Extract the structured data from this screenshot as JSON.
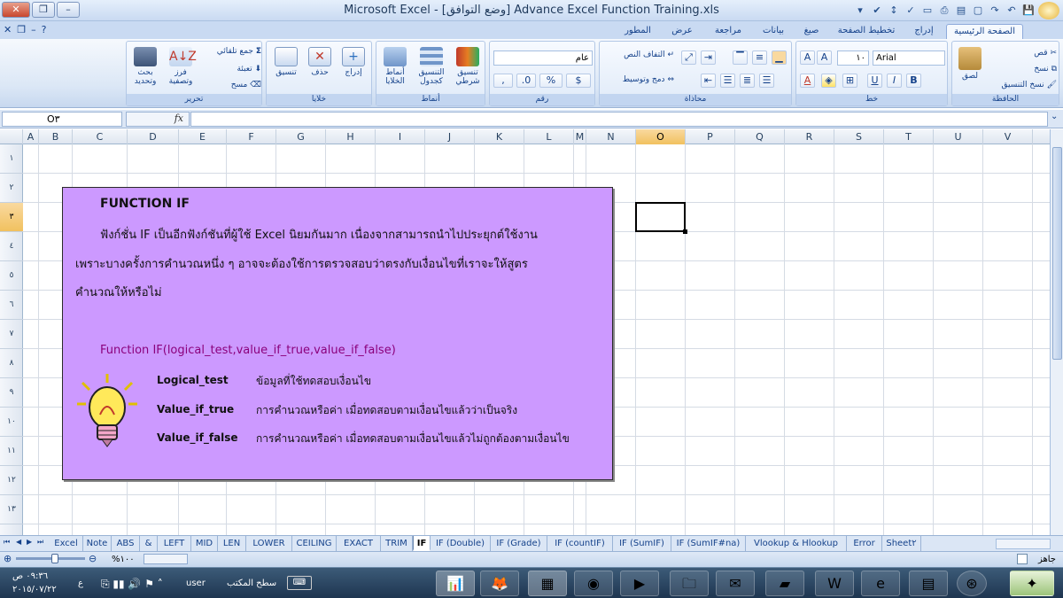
{
  "window": {
    "title": "Microsoft Excel - [وضع التوافق]  Advance Excel Function Training.xls"
  },
  "tabs": [
    "الصفحة الرئيسية",
    "إدراج",
    "تخطيط الصفحة",
    "صيغ",
    "بيانات",
    "مراجعة",
    "عرض",
    "المطور"
  ],
  "ribbon": {
    "clipboard": {
      "label": "الحافظة",
      "paste": "لصق",
      "cut": "قص",
      "copy": "نسخ",
      "format_painter": "نسخ التنسيق"
    },
    "font": {
      "label": "خط",
      "font_name": "Arial",
      "font_size": "١٠",
      "bold": "B",
      "italic": "I",
      "underline": "U"
    },
    "alignment": {
      "label": "محاذاة",
      "wrap": "التفاف النص",
      "merge": "دمج وتوسيط"
    },
    "number": {
      "label": "رقم",
      "format": "عام",
      "currency": "$",
      "percent": "%"
    },
    "styles": {
      "label": "أنماط",
      "conditional": "تنسيق شرطي",
      "table": "التنسيق كجدول",
      "cell_styles": "أنماط الخلايا"
    },
    "cells": {
      "label": "خلايا",
      "insert": "إدراج",
      "delete": "حذف",
      "format": "تنسيق"
    },
    "editing": {
      "label": "تحرير",
      "autosum": "جمع تلقائي",
      "fill": "تعبئة",
      "clear": "مسح",
      "sort": "فرز وتصفية",
      "find": "بحث وتحديد"
    }
  },
  "formula_bar": {
    "name_box": "O٣",
    "fx": "fx",
    "formula": ""
  },
  "columns": [
    "A",
    "B",
    "C",
    "D",
    "E",
    "F",
    "G",
    "H",
    "I",
    "J",
    "K",
    "L",
    "M",
    "N",
    "O",
    "P",
    "Q",
    "R",
    "S",
    "T",
    "U",
    "V"
  ],
  "rows": [
    "١",
    "٢",
    "٣",
    "٤",
    "٥",
    "٦",
    "٧",
    "٨",
    "٩",
    "١٠",
    "١١",
    "١٢",
    "١٣"
  ],
  "selected": {
    "column": "O",
    "row": "٣"
  },
  "infobox": {
    "title": "FUNCTION IF",
    "line1": "ฟังก์ชั่น IF เป็นอีกฟังก์ชันที่ผู้ใช้ Excel นิยมกันมาก เนื่องจากสามารถนำไปประยุกต์ใช้งาน",
    "line2": "เพราะบางครั้งการคำนวณหนึ่ง ๆ อาจจะต้องใช้การตรวจสอบว่าตรงกับเงื่อนไขที่เราจะให้สูตร",
    "line3": "คำนวณให้หรือไม่",
    "syntax_keyword": "Function",
    "syntax": "IF(logical_test,value_if_true,value_if_false)",
    "params": [
      {
        "name": "Logical_test",
        "desc": "ข้อมูลที่ใช้ทดสอบเงื่อนไข"
      },
      {
        "name": "Value_if_true",
        "desc": "การคำนวณหรือค่า  เมื่อทดสอบตามเงื่อนไขแล้วว่าเป็นจริง"
      },
      {
        "name": "Value_if_false",
        "desc": "การคำนวณหรือค่า  เมื่อทดสอบตามเงื่อนไขแล้วไม่ถูกต้องตามเงื่อนไข"
      }
    ]
  },
  "sheet_tabs": [
    "Excel",
    "Note",
    "ABS",
    "&",
    "LEFT",
    "MID",
    "LEN",
    "LOWER",
    "CEILING",
    "EXACT",
    "TRIM",
    "IF",
    "IF (Double)",
    "IF (Grade)",
    "IF (countIF)",
    "IF (SumIF)",
    "IF (SumIF#na)",
    "Vlookup & Hlookup",
    "Error",
    "Sheet٢"
  ],
  "active_sheet": "IF",
  "status": {
    "ready": "جاهز",
    "zoom": "%١٠٠"
  },
  "taskbar": {
    "desktop": "سطح المكتب",
    "user": "user",
    "lang": "ع",
    "time": "٠٩:٣٦ ص",
    "date": "٢٠١٥/٠٧/٢٢"
  }
}
